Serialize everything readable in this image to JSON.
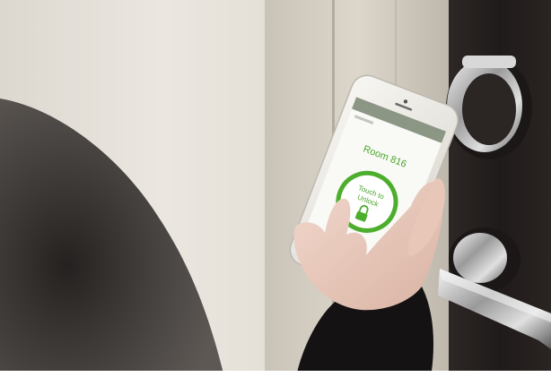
{
  "app": {
    "header_title": "",
    "brand": "",
    "room_label": "Room 816",
    "unlock_label_line1": "Touch to",
    "unlock_label_line2": "Unlock"
  },
  "icons": {
    "unlock": "padlock-icon",
    "camera": "front-camera",
    "speaker": "earpiece-speaker"
  },
  "colors": {
    "accent_green": "#4cae2c",
    "header_gray": "#8b9685",
    "wall": "#e6e2da",
    "door": "#262221"
  }
}
